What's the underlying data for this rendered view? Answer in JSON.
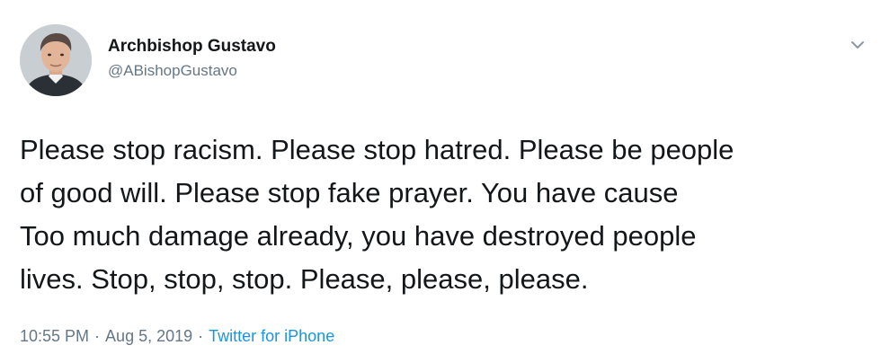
{
  "tweet": {
    "display_name": "Archbishop Gustavo",
    "handle": "@ABishopGustavo",
    "text": "Please stop racism. Please stop hatred. Please be people\nof good will. Please stop fake prayer. You  have cause\nToo much damage already,  you have destroyed people\nlives. Stop, stop, stop. Please, please, please.",
    "time": "10:55 PM",
    "separator": "·",
    "date": "Aug 5, 2019",
    "source": "Twitter for iPhone"
  },
  "icons": {
    "avatar": "profile-photo",
    "menu": "chevron-down-icon"
  },
  "colors": {
    "text": "#14171a",
    "secondary": "#657786",
    "link": "#1b95e0",
    "background": "#ffffff"
  }
}
